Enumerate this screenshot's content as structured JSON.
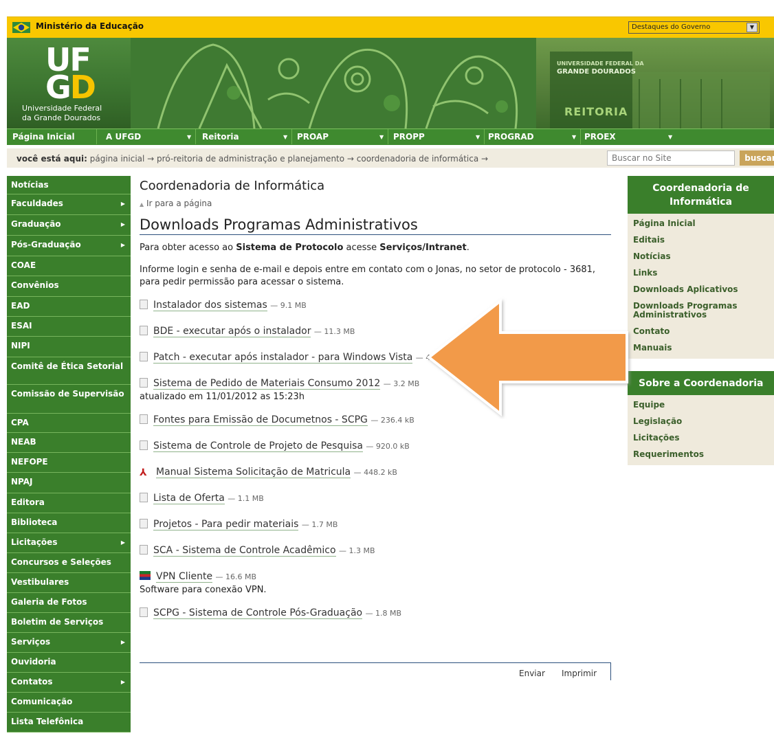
{
  "govbar": {
    "ministry": "Ministério da Educação",
    "select_value": "Destaques do Governo"
  },
  "banner": {
    "logo_top": "UF",
    "logo_bottom_g": "G",
    "logo_bottom_d": "D",
    "university_line1": "Universidade Federal",
    "university_line2": "da Grande Dourados",
    "building_sign_line1": "UNIVERSIDADE FEDERAL DA",
    "building_sign_line2": "GRANDE DOURADOS",
    "building_label": "REITORIA"
  },
  "topnav": {
    "items": [
      "Página Inicial",
      "A UFGD",
      "Reitoria",
      "PROAP",
      "PROPP",
      "PROGRAD",
      "PROEX"
    ]
  },
  "breadcrumb": {
    "label": "você está aqui:",
    "path": "página inicial → pró-reitoria de administração e planejamento → coordenadoria de informática →",
    "search_placeholder": "Buscar no Site",
    "search_button": "buscar"
  },
  "leftnav": {
    "items": [
      {
        "label": "Notícias"
      },
      {
        "label": "Faculdades"
      },
      {
        "label": "Graduação"
      },
      {
        "label": "Pós-Graduação"
      },
      {
        "label": "COAE"
      },
      {
        "label": "Convênios"
      },
      {
        "label": "EAD"
      },
      {
        "label": "ESAI"
      },
      {
        "label": "NIPI"
      },
      {
        "label": "Comitê de Ética Setorial"
      },
      {
        "label": "Comissão de Supervisão"
      },
      {
        "label": "CPA"
      },
      {
        "label": "NEAB"
      },
      {
        "label": "NEFOPE"
      },
      {
        "label": "NPAJ"
      },
      {
        "label": "Editora"
      },
      {
        "label": "Biblioteca"
      },
      {
        "label": "Licitações"
      },
      {
        "label": "Concursos e Seleções"
      },
      {
        "label": "Vestibulares"
      },
      {
        "label": "Galeria de Fotos"
      },
      {
        "label": "Boletim de Serviços"
      },
      {
        "label": "Serviços"
      },
      {
        "label": "Ouvidoria"
      },
      {
        "label": "Contatos"
      },
      {
        "label": "Comunicação"
      },
      {
        "label": "Lista Telefônica"
      }
    ]
  },
  "main": {
    "title": "Coordenadoria de Informática",
    "go_to_page": "Ir para a página",
    "heading": "Downloads Programas Administrativos",
    "intro_prefix": "Para obter acesso ao ",
    "intro_bold1": "Sistema de Protocolo",
    "intro_mid": " acesse ",
    "intro_bold2": "Serviços/Intranet",
    "intro_suffix": ".",
    "paragraph": "Informe login e senha de e-mail e depois entre em contato com o Jonas, no setor de protocolo - 3681, para pedir permissão para acessar o sistema.",
    "downloads": [
      {
        "name": "Instalador dos sistemas",
        "size": "— 9.1 MB",
        "icon": "file-icon"
      },
      {
        "name": "BDE - executar após o instalador",
        "size": "— 11.3 MB",
        "icon": "file-icon"
      },
      {
        "name": "Patch - executar após instalador - para Windows Vista",
        "size": "— 40.",
        "icon": "file-icon"
      },
      {
        "name": "Sistema de Pedido de Materiais Consumo 2012",
        "size": "— 3.2 MB",
        "icon": "file-icon",
        "note": "atualizado em 11/01/2012 as 15:23h"
      },
      {
        "name": "Fontes para Emissão de Documetnos - SCPG",
        "size": "— 236.4 kB",
        "icon": "file-icon"
      },
      {
        "name": "Sistema de Controle de Projeto de Pesquisa",
        "size": "— 920.0 kB",
        "icon": "file-icon"
      },
      {
        "name": "Manual Sistema Solicitação de Matricula",
        "size": "— 448.2 kB",
        "icon": "pdf-icon"
      },
      {
        "name": "Lista de Oferta",
        "size": "— 1.1 MB",
        "icon": "file-icon"
      },
      {
        "name": "Projetos - Para pedir materiais",
        "size": "— 1.7 MB",
        "icon": "file-icon"
      },
      {
        "name": "SCA - Sistema de Controle Acadêmico",
        "size": "— 1.3 MB",
        "icon": "file-icon"
      },
      {
        "name": "VPN Cliente",
        "size": "— 16.6 MB",
        "icon": "archive-icon",
        "note": "Software para conexão VPN."
      },
      {
        "name": "SCPG - Sistema de Controle Pós-Graduação",
        "size": "— 1.8 MB",
        "icon": "file-icon"
      }
    ],
    "footer_send": "Enviar",
    "footer_print": "Imprimir"
  },
  "rightnav": {
    "section1_title": "Coordenadoria de Informática",
    "section1_items": [
      "Página Inicial",
      "Editais",
      "Notícias",
      "Links",
      "Downloads Aplicativos",
      "Downloads Programas Administrativos",
      "Contato",
      "Manuais"
    ],
    "section2_title": "Sobre a Coordenadoria",
    "section2_items": [
      "Equipe",
      "Legislação",
      "Licitações",
      "Requerimentos"
    ]
  },
  "colors": {
    "gov_yellow": "#f9c700",
    "nav_green": "#3a7f2b",
    "annotation_arrow": "#f29a4a"
  }
}
